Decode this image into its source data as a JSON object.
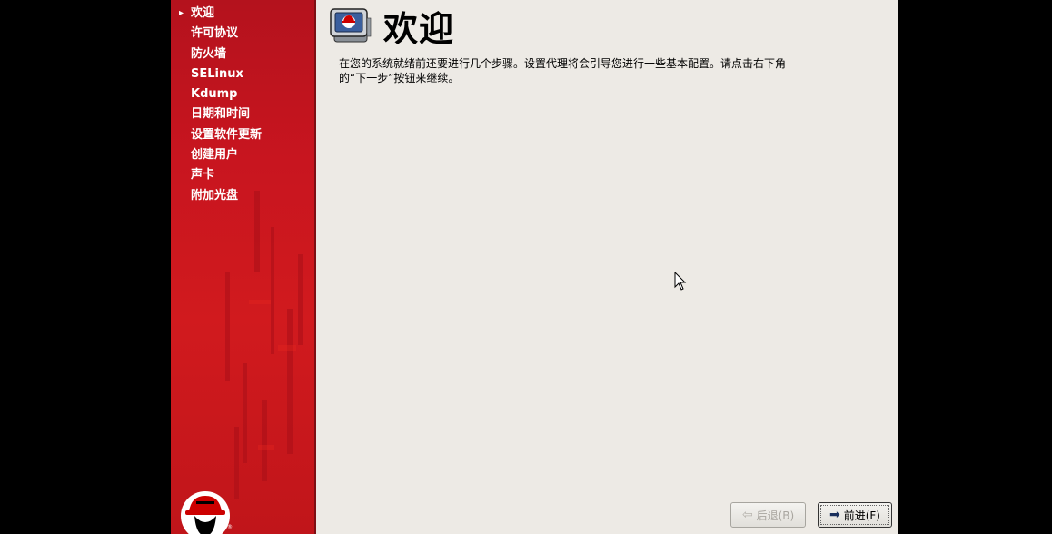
{
  "sidebar": {
    "items": [
      {
        "label": "欢迎",
        "active": true
      },
      {
        "label": "许可协议"
      },
      {
        "label": "防火墙"
      },
      {
        "label": "SELinux"
      },
      {
        "label": "Kdump"
      },
      {
        "label": "日期和时间"
      },
      {
        "label": "设置软件更新"
      },
      {
        "label": "创建用户"
      },
      {
        "label": "声卡"
      },
      {
        "label": "附加光盘"
      }
    ],
    "active_marker": "▸",
    "logo_icon": "redhat-shadowman-logo",
    "colors": {
      "background": "#c8151f",
      "text": "#ffffff"
    }
  },
  "main": {
    "title": "欢迎",
    "title_icon": "monitor-redhat-icon",
    "description": "在您的系统就绪前还要进行几个步骤。设置代理将会引导您进行一些基本配置。请点击右下角的“下一步”按钮来继续。"
  },
  "buttons": {
    "back_label": "后退(B)",
    "back_icon": "arrow-left-icon",
    "back_enabled": false,
    "forward_label": "前进(F)",
    "forward_icon": "arrow-right-icon"
  }
}
